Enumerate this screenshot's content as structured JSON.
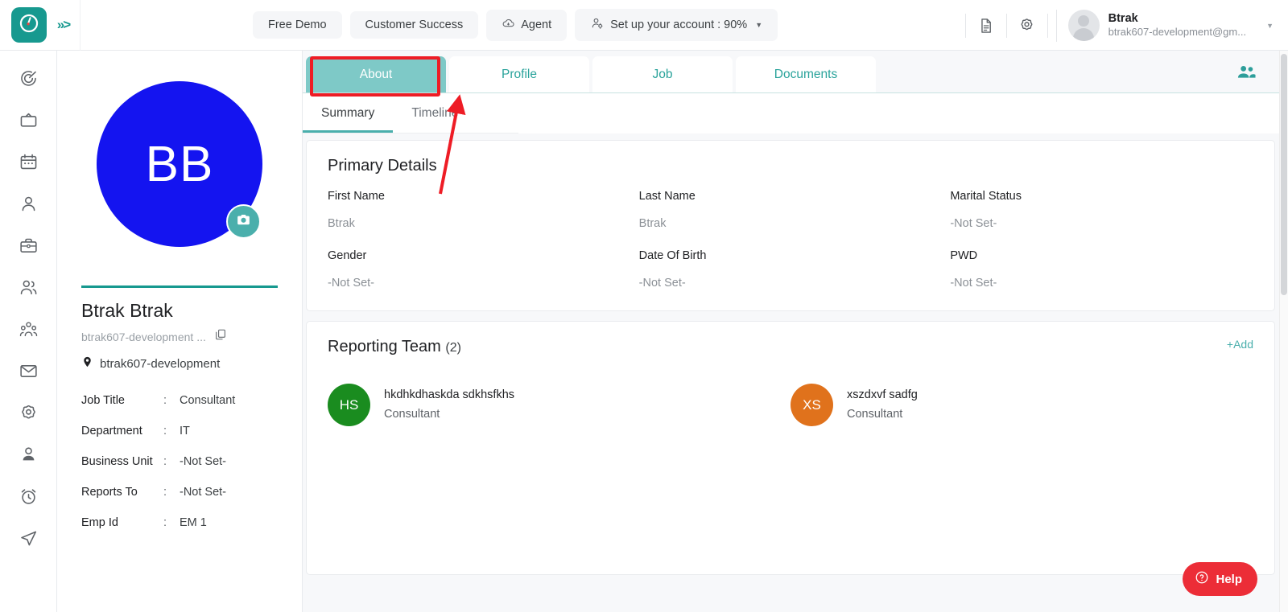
{
  "header": {
    "logo_icon": "clock-logo-icon",
    "expand_icon": "chevron-double-right-icon",
    "nav_buttons": [
      {
        "label": "Free Demo",
        "icon": null,
        "caret": false
      },
      {
        "label": "Customer Success",
        "icon": null,
        "caret": false
      },
      {
        "label": "Agent",
        "icon": "cloud-download-icon",
        "caret": false
      },
      {
        "label": "Set up your account : 90%",
        "icon": "user-settings-icon",
        "caret": true
      }
    ],
    "icons": [
      {
        "name": "document-icon"
      },
      {
        "name": "gear-icon"
      }
    ],
    "user": {
      "name": "Btrak",
      "email": "btrak607-development@gm...",
      "avatar_icon": "user-avatar-placeholder",
      "caret": "▾"
    }
  },
  "sidebar": {
    "items": [
      {
        "icon": "dashboard-spiral-icon",
        "name": "sidebar-item-dashboard"
      },
      {
        "icon": "tv-monitor-icon",
        "name": "sidebar-item-broadcast"
      },
      {
        "icon": "calendar-icon",
        "name": "sidebar-item-calendar"
      },
      {
        "icon": "person-icon",
        "name": "sidebar-item-employee"
      },
      {
        "icon": "briefcase-icon",
        "name": "sidebar-item-jobs"
      },
      {
        "icon": "users-icon",
        "name": "sidebar-item-teams"
      },
      {
        "icon": "org-group-icon",
        "name": "sidebar-item-organization"
      },
      {
        "icon": "mail-icon",
        "name": "sidebar-item-mail"
      },
      {
        "icon": "gear-icon",
        "name": "sidebar-item-settings"
      },
      {
        "icon": "user-badge-icon",
        "name": "sidebar-item-profile"
      },
      {
        "icon": "alarm-clock-icon",
        "name": "sidebar-item-attendance"
      },
      {
        "icon": "send-navigate-icon",
        "name": "sidebar-item-send"
      }
    ]
  },
  "profile_panel": {
    "avatar_initials": "BB",
    "avatar_color": "#1414f0",
    "camera_icon": "camera-icon",
    "camera_color": "#4aafac",
    "full_name": "Btrak Btrak",
    "email": "btrak607-development ...",
    "copy_icon": "copy-icon",
    "location_icon": "location-pin-icon",
    "location": "btrak607-development",
    "details": [
      {
        "key": "Job Title",
        "sep": ":",
        "value": "Consultant"
      },
      {
        "key": "Department",
        "sep": ":",
        "value": "IT"
      },
      {
        "key": "Business Unit",
        "sep": ":",
        "value": "-Not Set-"
      },
      {
        "key": "Reports To",
        "sep": ":",
        "value": "-Not Set-"
      },
      {
        "key": "Emp Id",
        "sep": ":",
        "value": "EM 1"
      }
    ]
  },
  "main": {
    "tabs": [
      {
        "label": "About",
        "active": true
      },
      {
        "label": "Profile",
        "active": false
      },
      {
        "label": "Job",
        "active": false
      },
      {
        "label": "Documents",
        "active": false
      }
    ],
    "people_icon": "team-people-icon",
    "subtabs": [
      {
        "label": "Summary",
        "active": true
      },
      {
        "label": "Timeline",
        "active": false
      }
    ],
    "primary_details": {
      "title": "Primary Details",
      "fields": [
        {
          "label": "First Name",
          "value": "Btrak"
        },
        {
          "label": "Last Name",
          "value": "Btrak"
        },
        {
          "label": "Marital Status",
          "value": "-Not Set-"
        },
        {
          "label": "Gender",
          "value": "-Not Set-"
        },
        {
          "label": "Date Of Birth",
          "value": "-Not Set-"
        },
        {
          "label": "PWD",
          "value": "-Not Set-"
        }
      ]
    },
    "reporting_team": {
      "title": "Reporting Team",
      "count": "(2)",
      "add_label": "+Add",
      "members": [
        {
          "initials": "HS",
          "color": "#1a8c1f",
          "name": "hkdhkdhaskda sdkhsfkhs",
          "role": "Consultant"
        },
        {
          "initials": "XS",
          "color": "#e0721c",
          "name": "xszdxvf sadfg",
          "role": "Consultant"
        }
      ]
    }
  },
  "help": {
    "label": "Help",
    "icon": "question-circle-icon",
    "color": "#ec2d37"
  },
  "theme": {
    "accent_teal": "#17998f",
    "tab_active": "#7ec9c7",
    "annotation_red": "#ee1c25"
  }
}
